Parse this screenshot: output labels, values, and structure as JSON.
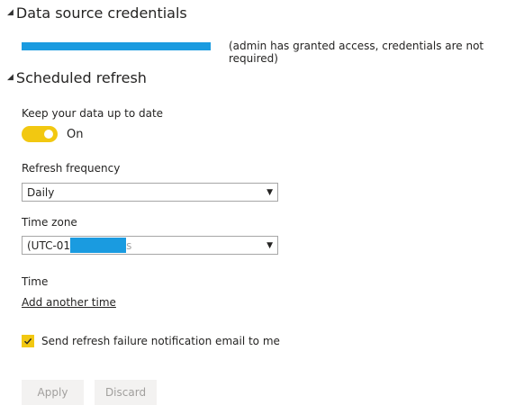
{
  "credentials": {
    "title": "Data source credentials",
    "note": "(admin has granted access, credentials are not required)"
  },
  "refresh": {
    "title": "Scheduled refresh",
    "keep_label": "Keep your data up to date",
    "toggle_state": "On",
    "frequency_label": "Refresh frequency",
    "frequency_value": "Daily",
    "timezone_label": "Time zone",
    "timezone_value_prefix": "(UTC-01",
    "timezone_value_suffix": "s",
    "time_label": "Time",
    "add_time_link": "Add another time",
    "notify_label": "Send refresh failure notification email to me"
  },
  "buttons": {
    "apply": "Apply",
    "discard": "Discard"
  },
  "icons": {
    "expand": "triangle-down-icon",
    "dropdown": "chevron-down-icon",
    "check": "checkmark-icon"
  },
  "colors": {
    "accent": "#f2c811",
    "redaction": "#1a9be0"
  }
}
